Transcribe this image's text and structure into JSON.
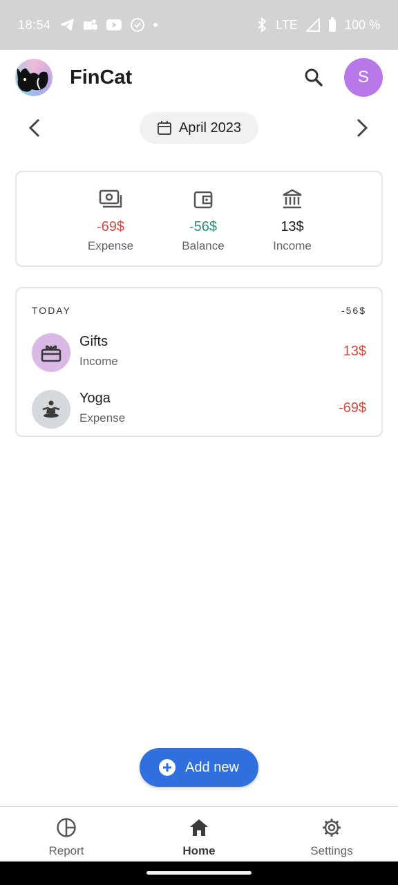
{
  "status_bar": {
    "time": "18:54",
    "network": "LTE",
    "battery": "100 %",
    "left_icons": [
      "telegram-icon",
      "teams-icon",
      "youtube-icon",
      "check-circle-icon",
      "dot-icon"
    ],
    "right_icons": [
      "bluetooth-icon",
      "signal-icon",
      "battery-icon"
    ]
  },
  "app_bar": {
    "title": "FinCat",
    "avatar_letter": "S",
    "logo_icon": "cat-logo-icon",
    "search_icon": "search-icon"
  },
  "month_nav": {
    "label": "April 2023",
    "prev_icon": "chevron-left-icon",
    "next_icon": "chevron-right-icon",
    "calendar_icon": "calendar-icon"
  },
  "summary": {
    "expense": {
      "value": "-69$",
      "label": "Expense",
      "icon": "cash-icon"
    },
    "balance": {
      "value": "-56$",
      "label": "Balance",
      "icon": "wallet-icon"
    },
    "income": {
      "value": "13$",
      "label": "Income",
      "icon": "bank-icon"
    }
  },
  "transactions": {
    "group_label": "TODAY",
    "group_total": "-56$",
    "items": [
      {
        "title": "Gifts",
        "subtitle": "Income",
        "amount": "13$",
        "icon": "gift-icon",
        "icon_bg": "#dbb9e6"
      },
      {
        "title": "Yoga",
        "subtitle": "Expense",
        "amount": "-69$",
        "icon": "yoga-icon",
        "icon_bg": "#d5d9dc"
      }
    ]
  },
  "fab": {
    "label": "Add new",
    "icon": "plus-circle-icon"
  },
  "bottom_nav": {
    "items": [
      {
        "label": "Report",
        "icon": "pie-chart-icon",
        "active": false
      },
      {
        "label": "Home",
        "icon": "home-icon",
        "active": true
      },
      {
        "label": "Settings",
        "icon": "gear-icon",
        "active": false
      }
    ]
  },
  "colors": {
    "accent": "#2f6fde",
    "expense_red": "#d24a40",
    "balance_green": "#2e8b7c",
    "avatar_purple": "#b978e8",
    "status_bar_bg": "#d3d3d3"
  }
}
